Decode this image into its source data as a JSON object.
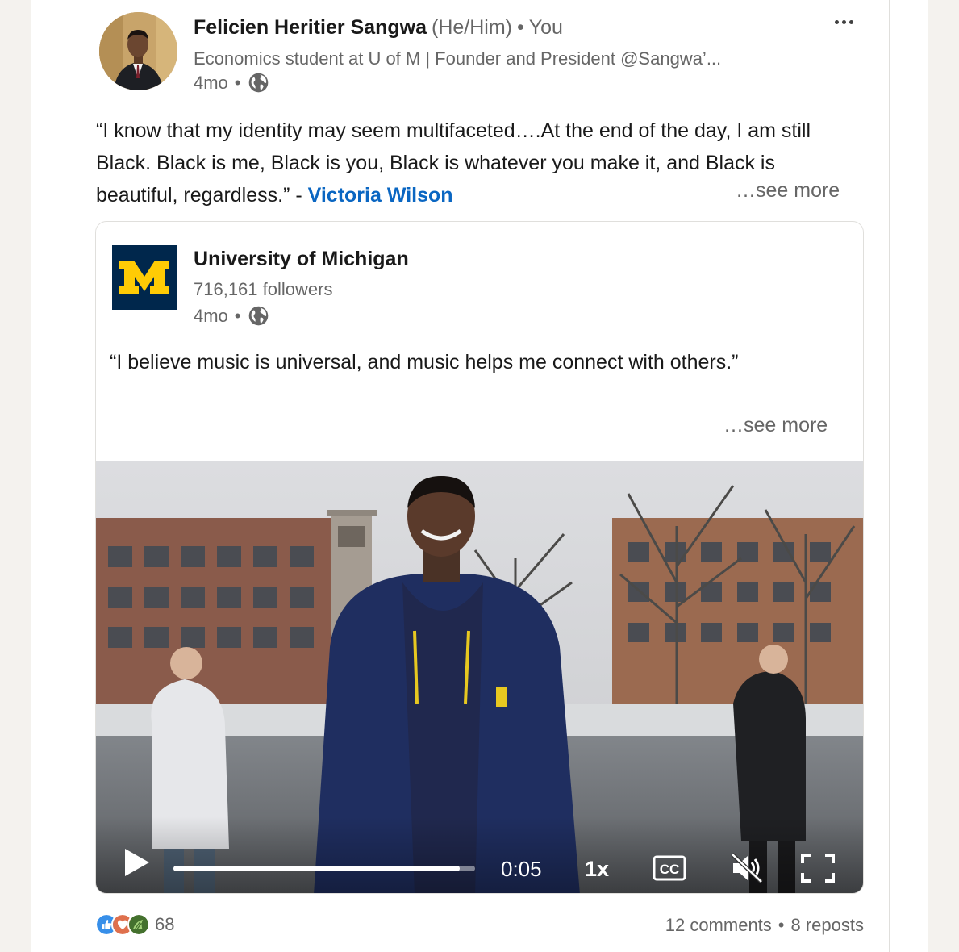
{
  "post": {
    "author_name": "Felicien Heritier Sangwa",
    "pronouns": "(He/Him)",
    "dot": "•",
    "you_label": "You",
    "headline": "Economics student at U of M | Founder and President @Sangwa’...",
    "time_ago": "4mo",
    "visibility_icon": "globe-icon",
    "text_before_mention": "“I know that my identity may seem multifaceted….At the end of the day, I am still Black. Black is me, Black is you, Black is whatever you make it, and Black is beautiful, regardless.” - ",
    "mention": "Victoria Wilson",
    "see_more": "…see more"
  },
  "shared": {
    "org_name": "University of Michigan",
    "logo_letter": "M",
    "followers": "716,161 followers",
    "time_ago": "4mo",
    "text": "“I believe music is universal, and music helps me connect with others.”",
    "see_more": "…see more"
  },
  "video": {
    "time": "0:05",
    "speed": "1x",
    "cc_label": "CC",
    "progress": 0.95,
    "muted": true
  },
  "social": {
    "reaction_count": "68",
    "comments": "12 comments",
    "separator": "•",
    "reposts": "8 reposts",
    "reaction_icons": [
      "like-icon",
      "love-icon",
      "support-icon"
    ]
  },
  "colors": {
    "accent": "#0a66c2",
    "um_blue": "#00274c",
    "um_maize": "#ffcb05"
  }
}
